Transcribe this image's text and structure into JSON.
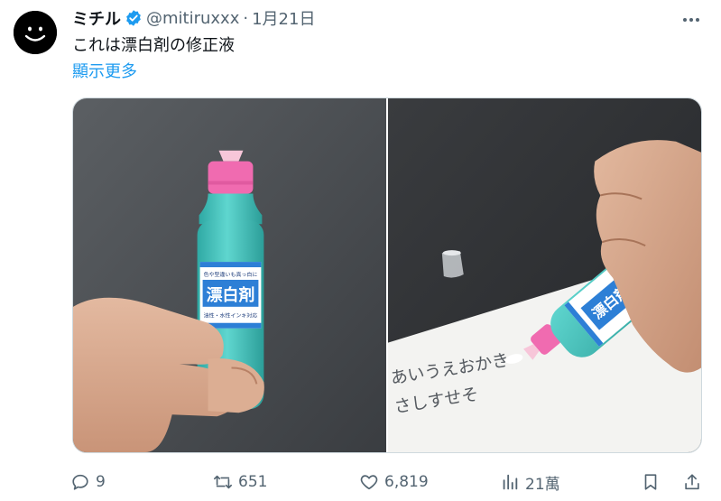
{
  "tweet": {
    "author_name": "ミチル",
    "handle": "@mitiruxxx",
    "separator": "·",
    "date": "1月21日",
    "text": "これは漂白剤の修正液",
    "show_more": "顯示更多"
  },
  "media": {
    "left": {
      "label_top": "色や型違いも真っ白に",
      "label_main": "漂白剤",
      "label_bottom": "油性・水性インキ対応"
    },
    "right": {
      "handwriting_line1": "あいうえおかき",
      "handwriting_line2": "さしすせそ",
      "label_main": "漂白剤"
    }
  },
  "actions": {
    "replies": "9",
    "retweets": "651",
    "likes": "6,819",
    "views": "21萬"
  },
  "colors": {
    "link": "#1d9bf0",
    "muted": "#536471",
    "verified": "#1d9bf0",
    "bottle_body": "#4ecbc4",
    "bottle_cap": "#f06bb0"
  }
}
